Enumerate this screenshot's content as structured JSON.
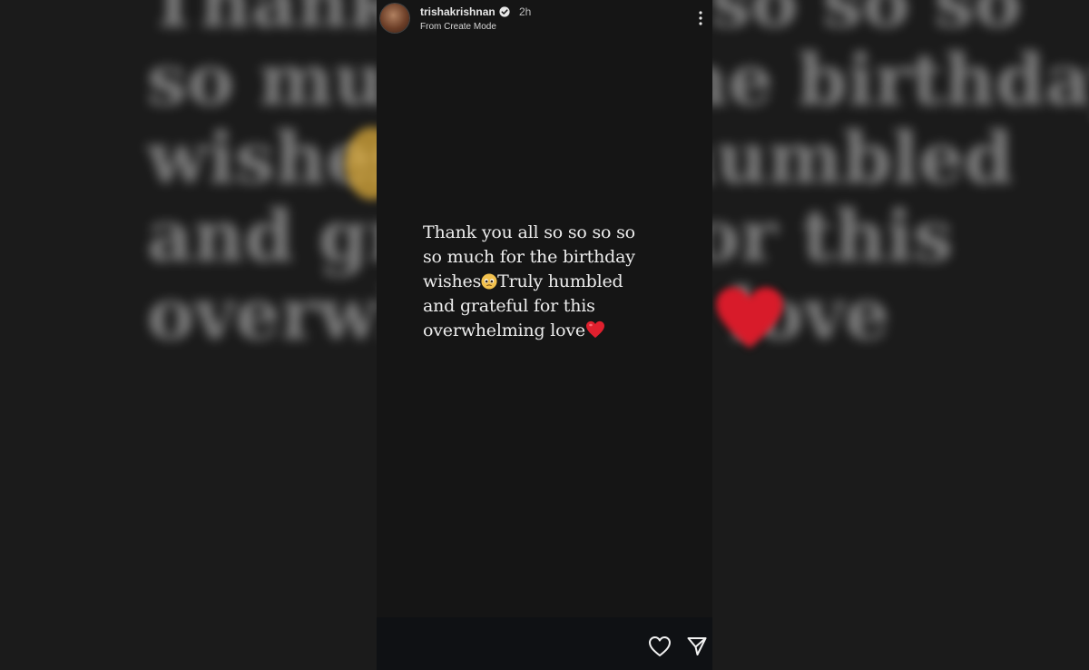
{
  "header": {
    "username": "trishakrishnan",
    "time": "2h",
    "subtitle": "From Create Mode"
  },
  "story": {
    "lines": [
      "Thank you all so so so so",
      "so much for the birthday",
      "wishes",
      "Truly humbled",
      "and grateful for this",
      "overwhelming love"
    ]
  },
  "backdrop": {
    "lines": [
      "Thank you all so so so",
      "so much for the birthday",
      "wishes   Truly humbled",
      "and grateful for this",
      "overwhelming love"
    ]
  },
  "colors": {
    "background": "#1b1b1b",
    "story_background": "#151515",
    "footer_background": "#0f1114",
    "heart_red": "#e0202e",
    "emoji_yellow": "#f2c14e"
  },
  "icons": {
    "verified": "verified-badge-icon",
    "more": "more-vertical-icon",
    "like": "heart-outline-icon",
    "send": "send-paper-plane-icon"
  }
}
